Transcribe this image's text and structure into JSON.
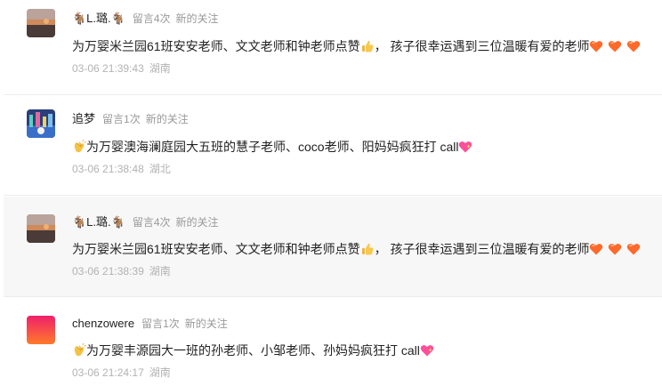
{
  "comments": [
    {
      "nickname": "🐐L.璐.🐐",
      "count": "留言4次",
      "tag": "新的关注",
      "text": "为万婴米兰园61班安安老师、文文老师和钟老师点赞",
      "text_suffix": "， 孩子很幸运遇到三位温暖有爱的老师",
      "time": "03-06 21:39:43",
      "location": "湖南",
      "avatar": "sunset-avatar"
    },
    {
      "nickname": "追梦",
      "count": "留言1次",
      "tag": "新的关注",
      "text": "为万婴澳海澜庭园大五班的慧子老师、coco老师、阳妈妈疯狂打 call",
      "time": "03-06 21:38:48",
      "location": "湖北",
      "avatar": "night-city-avatar"
    },
    {
      "nickname": "🐐L.璐.🐐",
      "count": "留言4次",
      "tag": "新的关注",
      "text": "为万婴米兰园61班安安老师、文文老师和钟老师点赞",
      "text_suffix": "， 孩子很幸运遇到三位温暖有爱的老师",
      "time": "03-06 21:38:39",
      "location": "湖南",
      "avatar": "sunset-avatar"
    },
    {
      "nickname": "chenzowere",
      "count": "留言1次",
      "tag": "新的关注",
      "text": "为万婴丰源园大一班的孙老师、小邹老师、孙妈妈疯狂打 call",
      "time": "03-06 21:24:17",
      "location": "湖南",
      "avatar": "red-gradient-avatar"
    }
  ]
}
